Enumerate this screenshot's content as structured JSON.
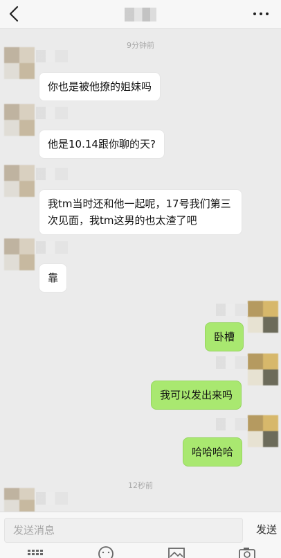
{
  "header": {
    "back_icon": "back-chevron-icon",
    "more_icon": "more-dots-icon"
  },
  "messages": [
    {
      "type": "timestamp",
      "text": "9分钟前"
    },
    {
      "from": "other",
      "text": "你也是被他撩的姐妹吗"
    },
    {
      "from": "other",
      "text": "他是10.14跟你聊的天?"
    },
    {
      "from": "other",
      "text": "我tm当时还和他一起呢，17号我们第三次见面，我tm这男的也太渣了吧"
    },
    {
      "from": "other",
      "text": "靠"
    },
    {
      "from": "me",
      "text": "卧槽"
    },
    {
      "from": "me",
      "text": "我可以发出来吗"
    },
    {
      "from": "me",
      "text": "哈哈哈哈"
    },
    {
      "type": "timestamp",
      "text": "12秒前"
    }
  ],
  "input": {
    "placeholder": "发送消息",
    "send_label": "发送"
  },
  "toolbar": {
    "items": [
      "keyboard-icon",
      "emoji-icon",
      "image-icon",
      "camera-icon"
    ]
  },
  "colors": {
    "background": "#ebebeb",
    "bubble_me": "#a9e870",
    "bubble_other": "#ffffff"
  }
}
